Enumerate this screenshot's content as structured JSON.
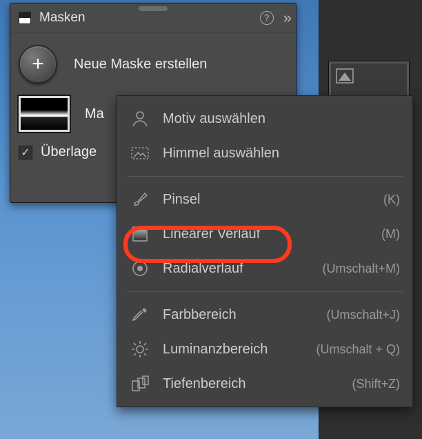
{
  "panel": {
    "title": "Masken",
    "create_label": "Neue Maske erstellen",
    "mask1_label": "Ma",
    "overlay_label": "Überlage"
  },
  "menu": {
    "items": [
      {
        "icon": "person-icon",
        "label": "Motiv auswählen",
        "shortcut": ""
      },
      {
        "icon": "sky-icon",
        "label": "Himmel auswählen",
        "shortcut": ""
      },
      {
        "sep": true
      },
      {
        "icon": "brush-icon",
        "label": "Pinsel",
        "shortcut": "(K)"
      },
      {
        "icon": "gradient-icon",
        "label": "Linearer Verlauf",
        "shortcut": "(M)"
      },
      {
        "icon": "radial-icon",
        "label": "Radialverlauf",
        "shortcut": "(Umschalt+M)"
      },
      {
        "sep": true
      },
      {
        "icon": "eyedrop-icon",
        "label": "Farbbereich",
        "shortcut": "(Umschalt+J)"
      },
      {
        "icon": "luminance-icon",
        "label": "Luminanzbereich",
        "shortcut": "(Umschalt + Q)"
      },
      {
        "icon": "depth-icon",
        "label": "Tiefenbereich",
        "shortcut": "(Shift+Z)"
      }
    ]
  }
}
